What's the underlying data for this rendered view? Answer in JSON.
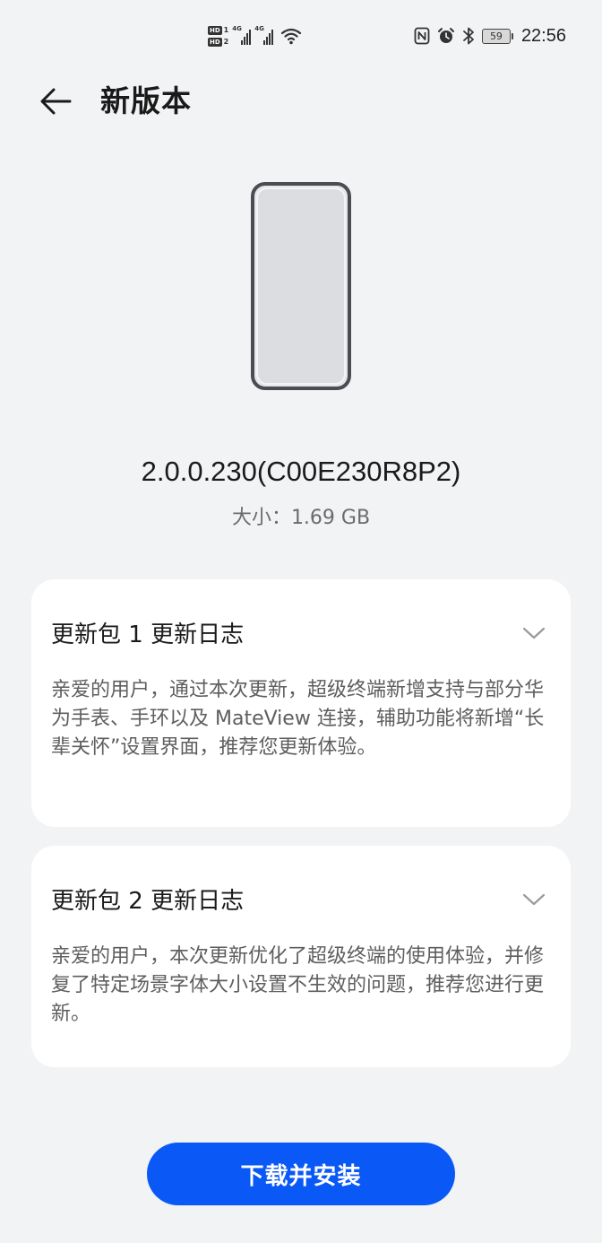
{
  "status_bar": {
    "sim1_label": "HD",
    "sim1_index": "1",
    "sim2_label": "HD",
    "sim2_index": "2",
    "network1": "4G",
    "network2": "4G",
    "battery": "59",
    "time": "22:56",
    "icons": [
      "nfc-icon",
      "alarm-icon",
      "bluetooth-icon",
      "wifi-icon",
      "signal-icon",
      "battery-icon"
    ]
  },
  "app_bar": {
    "title": "新版本",
    "back_icon": "arrow-left-icon"
  },
  "version_info": {
    "version": "2.0.0.230(C00E230R8P2)",
    "size": "大小：1.69 GB"
  },
  "update_logs": [
    {
      "title": "更新包 1 更新日志",
      "body": "亲爱的用户，通过本次更新，超级终端新增支持与部分华为手表、手环以及 MateView 连接，辅助功能将新增“长辈关怀”设置界面，推荐您更新体验。",
      "icon": "chevron-down-icon"
    },
    {
      "title": "更新包 2 更新日志",
      "body": "亲爱的用户，本次更新优化了超级终端的使用体验，并修复了特定场景字体大小设置不生效的问题，推荐您进行更新。",
      "icon": "chevron-down-icon"
    }
  ],
  "actions": {
    "download_label": "下载并安装"
  },
  "colors": {
    "background": "#f1f3f5",
    "card": "#ffffff",
    "accent": "#0a59f7",
    "secondary_text": "#5e5e5e"
  }
}
